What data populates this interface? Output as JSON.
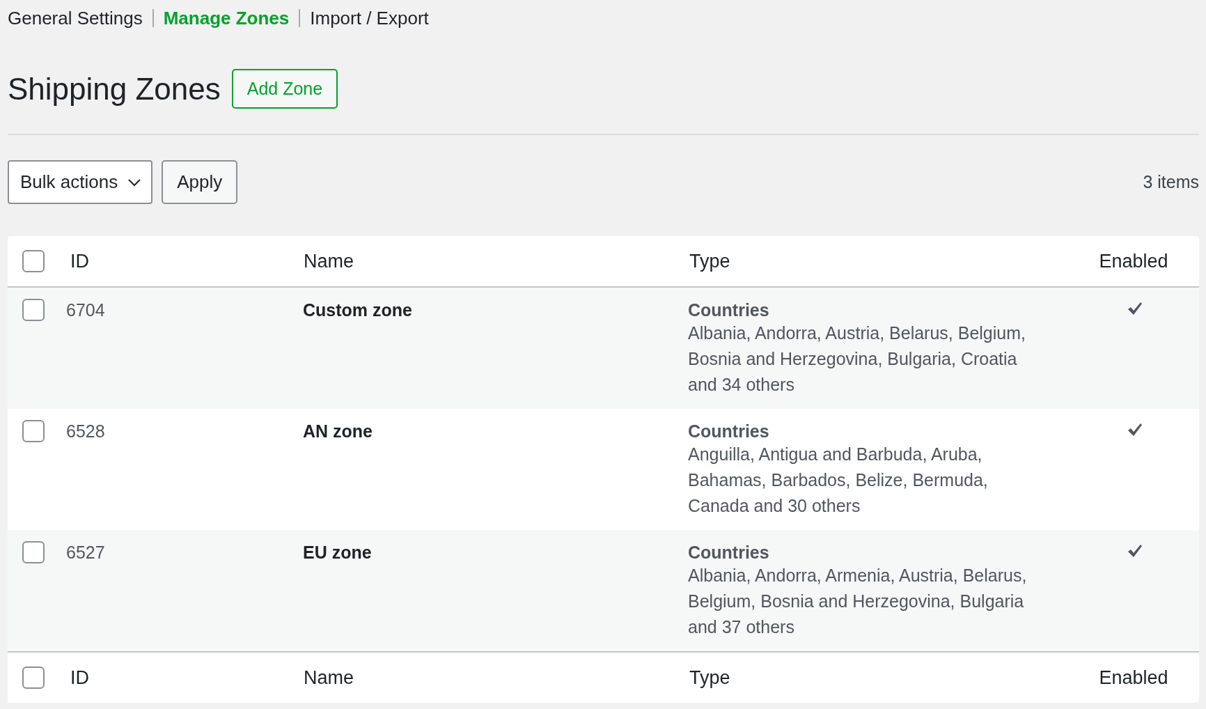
{
  "subnav": [
    {
      "label": "General Settings",
      "selected": false
    },
    {
      "label": "Manage Zones",
      "selected": true
    },
    {
      "label": "Import / Export",
      "selected": false
    }
  ],
  "page_title": "Shipping Zones",
  "add_button": "Add Zone",
  "bulk_actions": {
    "value": "Bulk actions"
  },
  "apply_button": "Apply",
  "item_count": "3 items",
  "table": {
    "columns": [
      "ID",
      "Name",
      "Type",
      "Enabled"
    ],
    "select_all_checked": false,
    "rows": [
      {
        "checked": false,
        "id": "6704",
        "name": "Custom zone",
        "type": "Countries",
        "regions": "Albania, Andorra, Austria, Belarus, Belgium, Bosnia and Herzegovina, Bulgaria, Croatia and 34 others",
        "enabled": true
      },
      {
        "checked": false,
        "id": "6528",
        "name": "AN zone",
        "type": "Countries",
        "regions": "Anguilla, Antigua and Barbuda, Aruba, Bahamas, Barbados, Belize, Bermuda, Canada and 30 others",
        "enabled": true
      },
      {
        "checked": false,
        "id": "6527",
        "name": "EU zone",
        "type": "Countries",
        "regions": "Albania, Andorra, Armenia, Austria, Belarus, Belgium, Bosnia and Herzegovina, Bulgaria and 37 others",
        "enabled": true
      }
    ],
    "footer_columns": [
      "ID",
      "Name",
      "Type",
      "Enabled"
    ],
    "footer_select_all_checked": false
  }
}
